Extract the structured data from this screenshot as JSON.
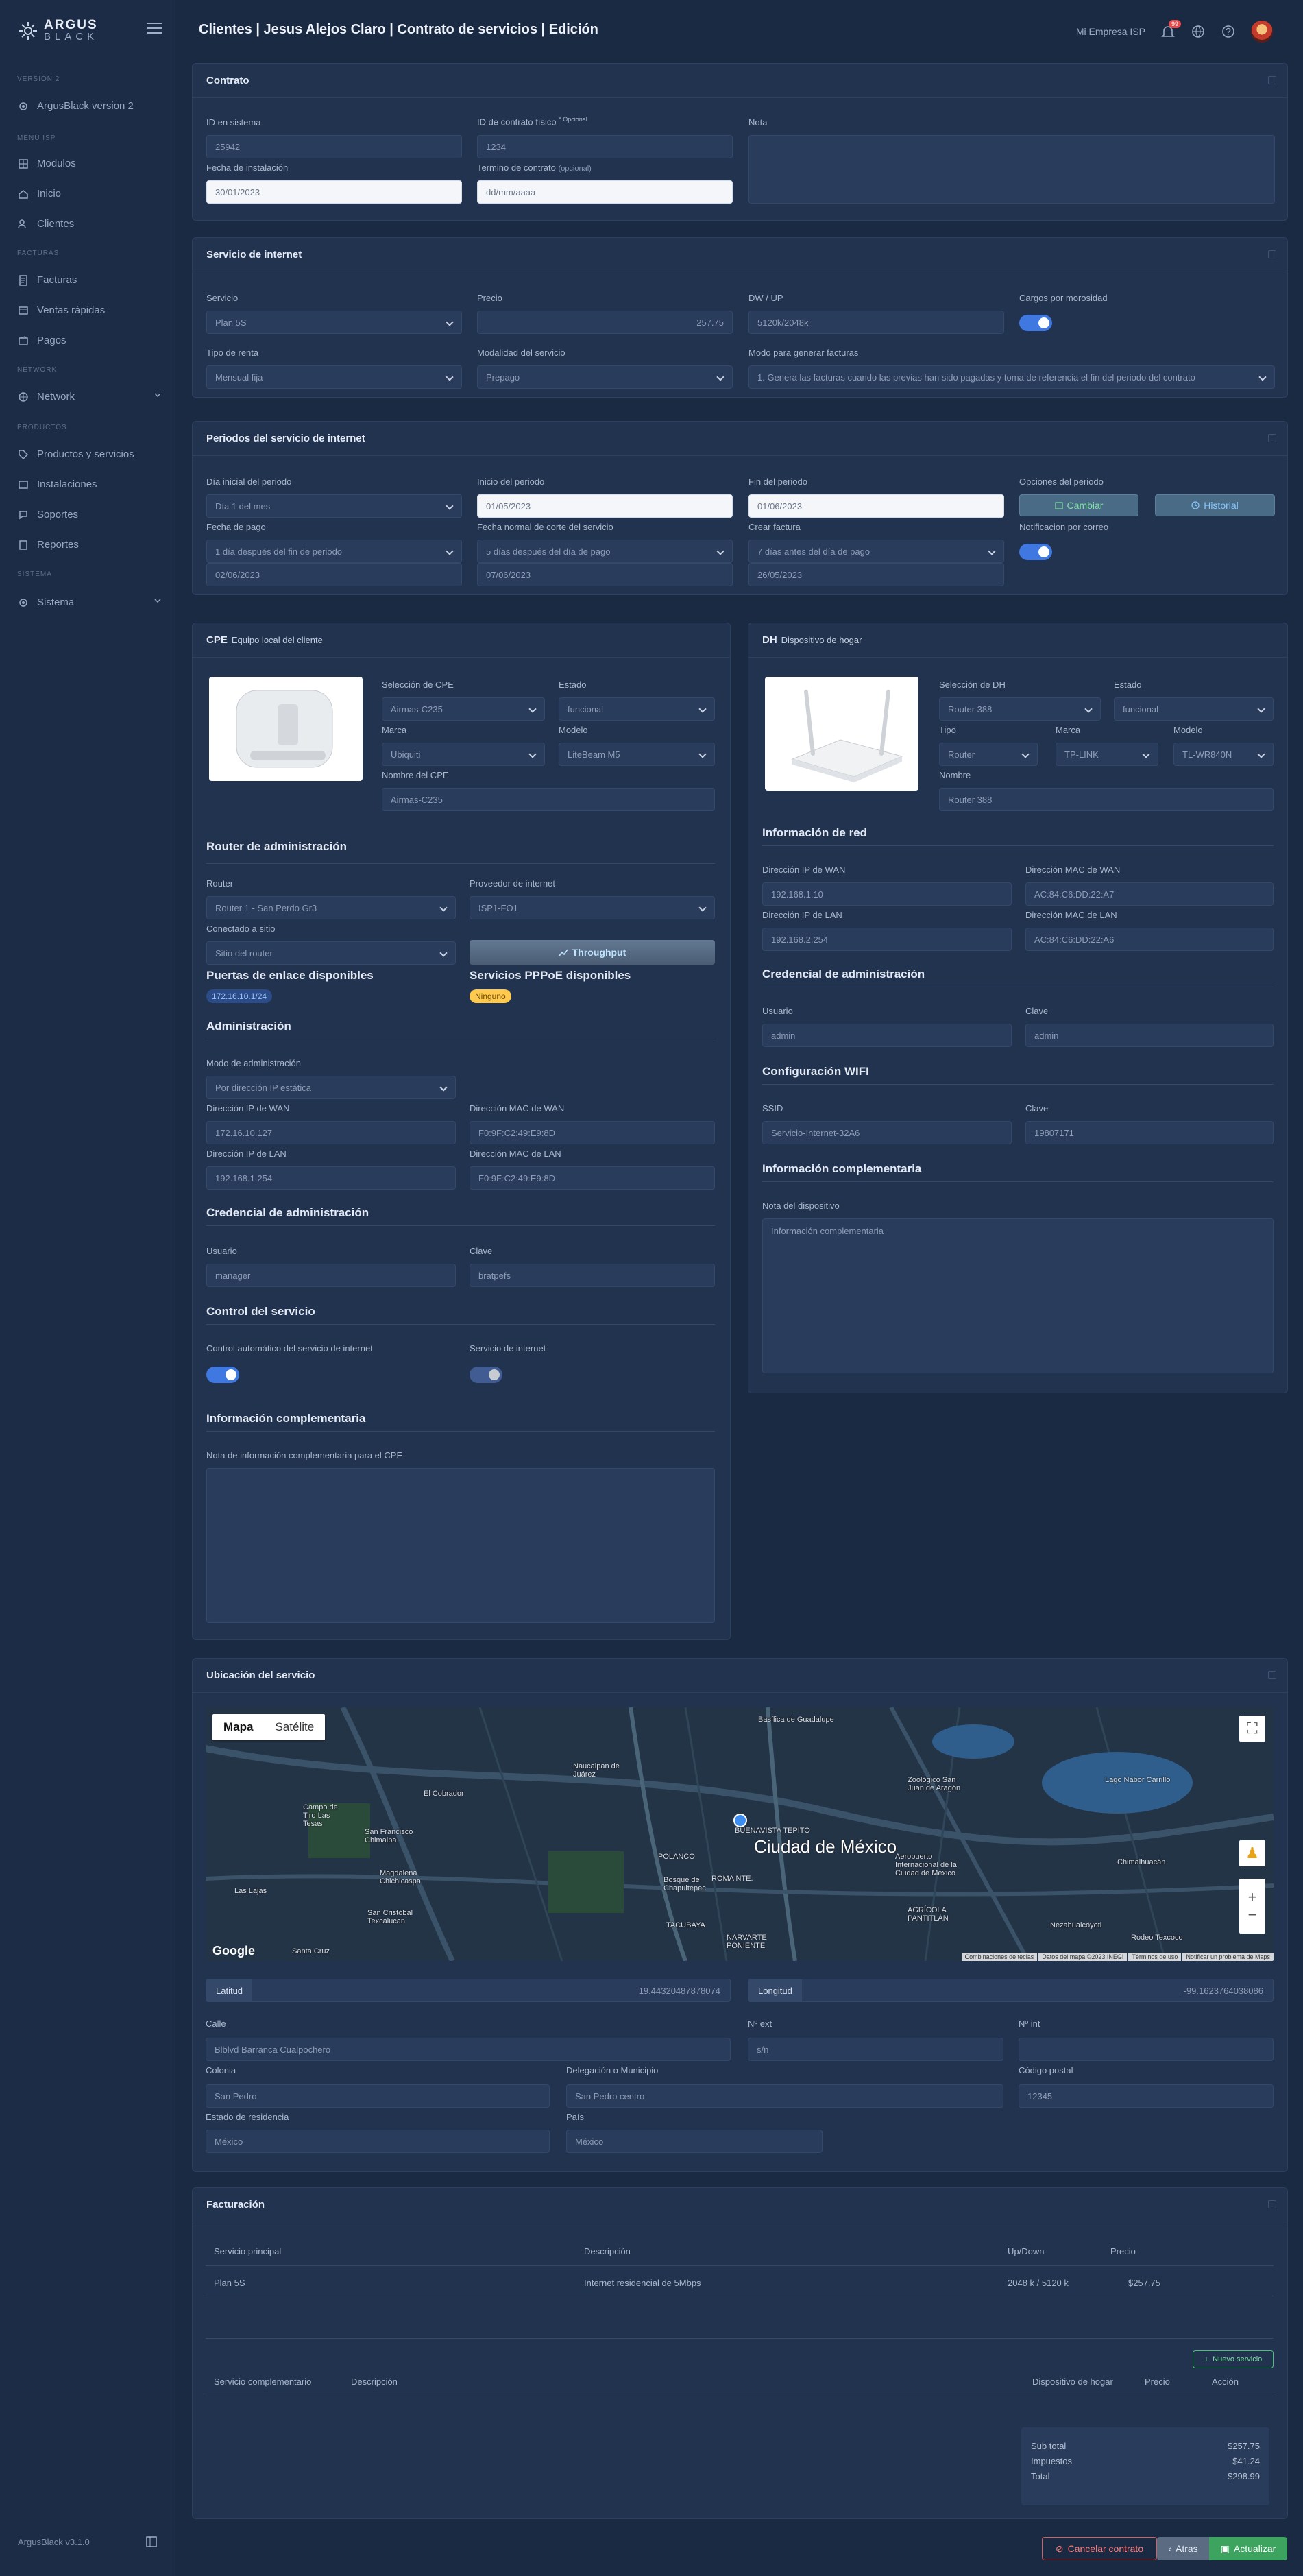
{
  "sidebar": {
    "logo_top": "ARGUS",
    "logo_bottom": "BLACK",
    "sections": {
      "version": "VERSIÓN 2",
      "menu": "MENÚ ISP",
      "facturas": "FACTURAS",
      "network": "NETWORK",
      "productos": "PRODUCTOS",
      "sistema": "SISTEMA"
    },
    "items": {
      "version": "ArgusBlack version 2",
      "modulos": "Modulos",
      "inicio": "Inicio",
      "clientes": "Clientes",
      "facturas": "Facturas",
      "ventas": "Ventas rápidas",
      "pagos": "Pagos",
      "network": "Network",
      "productos": "Productos y servicios",
      "instalaciones": "Instalaciones",
      "soportes": "Soportes",
      "reportes": "Reportes",
      "sistema": "Sistema"
    },
    "footer": "ArgusBlack v3.1.0"
  },
  "header": {
    "title": "Clientes | Jesus Alejos Claro | Contrato de servicios | Edición",
    "company": "Mi Empresa ISP",
    "notifications": "99"
  },
  "contrato": {
    "title": "Contrato",
    "id_label": "ID en sistema",
    "id_value": "25942",
    "fisico_label": "ID de contrato físico",
    "opcional": "* Opcional",
    "fisico_value": "1234",
    "nota_label": "Nota",
    "instalacion_label": "Fecha de instalación",
    "instalacion_value": "30/01/2023",
    "termino_label": "Termino de contrato",
    "termino_opt": "(opcional)",
    "termino_placeholder": "dd/mm/aaaa"
  },
  "internet": {
    "title": "Servicio de internet",
    "servicio_label": "Servicio",
    "servicio_value": "Plan 5S",
    "precio_label": "Precio",
    "precio_value": "257.75",
    "dwup_label": "DW / UP",
    "dwup_value": "5120k/2048k",
    "cargos_label": "Cargos por morosidad",
    "renta_label": "Tipo de renta",
    "renta_value": "Mensual fija",
    "modalidad_label": "Modalidad del servicio",
    "modalidad_value": "Prepago",
    "modo_label": "Modo para generar facturas",
    "modo_value": "1. Genera las facturas cuando las previas han sido pagadas y toma de referencia el fin del periodo del contrato"
  },
  "periodos": {
    "title": "Periodos del servicio de internet",
    "dia_label": "Día inicial del periodo",
    "dia_value": "Día 1 del mes",
    "inicio_label": "Inicio del periodo",
    "inicio_value": "01/05/2023",
    "fin_label": "Fin del periodo",
    "fin_value": "01/06/2023",
    "opciones_label": "Opciones del periodo",
    "cambiar": "Cambiar",
    "historial": "Historial",
    "pago_label": "Fecha de pago",
    "pago_value": "1 día después del fin de periodo",
    "pago_date": "02/06/2023",
    "corte_label": "Fecha normal de corte del servicio",
    "corte_value": "5 días después del día de pago",
    "corte_date": "07/06/2023",
    "crear_label": "Crear factura",
    "crear_value": "7 días antes del día de pago",
    "crear_date": "26/05/2023",
    "notif_label": "Notificacion por correo"
  },
  "cpe": {
    "title": "CPE",
    "subtitle": "Equipo local del cliente",
    "sel_label": "Selección de CPE",
    "sel_value": "Airmas-C235",
    "estado_label": "Estado",
    "estado_value": "funcional",
    "marca_label": "Marca",
    "marca_value": "Ubiquiti",
    "modelo_label": "Modelo",
    "modelo_value": "LiteBeam M5",
    "nombre_label": "Nombre del CPE",
    "nombre_value": "Airmas-C235",
    "router_title": "Router de administración",
    "router_label": "Router",
    "router_value": "Router 1 - San Perdo Gr3",
    "proveedor_label": "Proveedor de internet",
    "proveedor_value": "ISP1-FO1",
    "sitio_label": "Conectado a sitio",
    "sitio_value": "Sitio del router",
    "throughput": "Throughput",
    "puertas_title": "Puertas de enlace disponibles",
    "puertas_chip": "172.16.10.1/24",
    "pppoe_title": "Servicios PPPoE disponibles",
    "pppoe_chip": "Ninguno",
    "admin_title": "Administración",
    "modo_label": "Modo de administración",
    "modo_value": "Por dirección IP estática",
    "ipwan_label": "Dirección IP de WAN",
    "ipwan_value": "172.16.10.127",
    "macwan_label": "Dirección MAC de WAN",
    "macwan_value": "F0:9F:C2:49:E9:8D",
    "iplan_label": "Dirección IP de LAN",
    "iplan_value": "192.168.1.254",
    "maclan_label": "Dirección MAC de LAN",
    "maclan_value": "F0:9F:C2:49:E9:8D",
    "cred_title": "Credencial de administración",
    "usuario_label": "Usuario",
    "usuario_value": "manager",
    "clave_label": "Clave",
    "clave_value": "bratpefs",
    "control_title": "Control del servicio",
    "auto_label": "Control automático del servicio de internet",
    "serv_label": "Servicio de internet",
    "info_title": "Información complementaria",
    "nota_label": "Nota de información complementaria para el CPE"
  },
  "dh": {
    "title": "DH",
    "subtitle": "Dispositivo de hogar",
    "sel_label": "Selección de DH",
    "sel_value": "Router 388",
    "estado_label": "Estado",
    "estado_value": "funcional",
    "tipo_label": "Tipo",
    "tipo_value": "Router",
    "marca_label": "Marca",
    "marca_value": "TP-LINK",
    "modelo_label": "Modelo",
    "modelo_value": "TL-WR840N",
    "nombre_label": "Nombre",
    "nombre_value": "Router 388",
    "red_title": "Información de red",
    "ipwan_label": "Dirección IP de WAN",
    "ipwan_value": "192.168.1.10",
    "macwan_label": "Dirección MAC de WAN",
    "macwan_value": "AC:84:C6:DD:22:A7",
    "iplan_label": "Dirección IP de LAN",
    "iplan_value": "192.168.2.254",
    "maclan_label": "Dirección MAC de LAN",
    "maclan_value": "AC:84:C6:DD:22:A6",
    "cred_title": "Credencial de administración",
    "usuario_label": "Usuario",
    "usuario_value": "admin",
    "clave_label": "Clave",
    "clave_value": "admin",
    "wifi_title": "Configuración WIFI",
    "ssid_label": "SSID",
    "ssid_value": "Servicio-Internet-32A6",
    "wclave_label": "Clave",
    "wclave_value": "19807171",
    "info_title": "Información complementaria",
    "nota_label": "Nota del dispositivo",
    "nota_placeholder": "Información complementaria"
  },
  "ubicacion": {
    "title": "Ubicación del servicio",
    "map_tab_map": "Mapa",
    "map_tab_sat": "Satélite",
    "google": "Google",
    "map_labels": {
      "city": "Ciudad de México",
      "cobrador": "El Cobrador",
      "chimalpa": "San Francisco Chimalpa",
      "magdalena": "Magdalena Chichicaspa",
      "cristobal": "San Cristóbal Texcalucan",
      "lajas": "Las Lajas",
      "santacruz": "Santa Cruz",
      "naucalpan": "Naucalpan de Juárez",
      "chimalhuacan": "Chimalhuacán",
      "nezahualcoyotl": "Nezahualcóyotl",
      "texcoco": "Rodeo Texcoco",
      "aeropuerto": "Aeropuerto Internacional de la Ciudad de México",
      "agricola": "AGRÍCOLA PANTITLÁN",
      "tacubaya": "TACUBAYA",
      "narvarte": "NARVARTE PONIENTE",
      "polanco": "POLANCO",
      "roma": "ROMA NTE.",
      "chapultepec": "Bosque de Chapultepec",
      "tepito": "BUENAVISTA TEPITO",
      "gustavo": "Basílica de Guadalupe",
      "tolucas": "Campo de Tiro Las Tesas",
      "aragon": "Zoológico San Juan de Aragón",
      "lago": "Lago Nabor Carrillo"
    },
    "attr": [
      "Combinaciones de teclas",
      "Datos del mapa ©2023 INEGI",
      "Términos de uso",
      "Notificar un problema de Maps"
    ],
    "lat_label": "Latitud",
    "lat_value": "19.44320487878074",
    "lng_label": "Longitud",
    "lng_value": "-99.1623764038086",
    "calle_label": "Calle",
    "calle_value": "Blblvd Barranca Cualpochero",
    "next_label": "Nº ext",
    "next_value": "s/n",
    "nint_label": "Nº int",
    "colonia_label": "Colonia",
    "colonia_value": "San Pedro",
    "deleg_label": "Delegación o Municipio",
    "deleg_value": "San Pedro centro",
    "cp_label": "Código postal",
    "cp_value": "12345",
    "estado_label": "Estado de residencia",
    "estado_value": "México",
    "pais_label": "País",
    "pais_value": "México"
  },
  "facturacion": {
    "title": "Facturación",
    "cols": {
      "servicio": "Servicio principal",
      "descripcion": "Descripción",
      "updown": "Up/Down",
      "precio": "Precio"
    },
    "row": {
      "servicio": "Plan 5S",
      "descripcion": "Internet residencial de 5Mbps",
      "updown": "2048 k / 5120 k",
      "precio": "$257.75"
    },
    "nuevo": "Nuevo servicio",
    "cols2": {
      "servicio": "Servicio complementario",
      "descripcion": "Descripción",
      "dispositivo": "Dispositivo de hogar",
      "precio": "Precio",
      "accion": "Acción"
    },
    "subtotal_label": "Sub total",
    "subtotal": "$257.75",
    "impuestos_label": "Impuestos",
    "impuestos": "$41.24",
    "total_label": "Total",
    "total": "$298.99"
  },
  "footer": {
    "cancel": "Cancelar contrato",
    "back": "Atras",
    "update": "Actualizar"
  }
}
